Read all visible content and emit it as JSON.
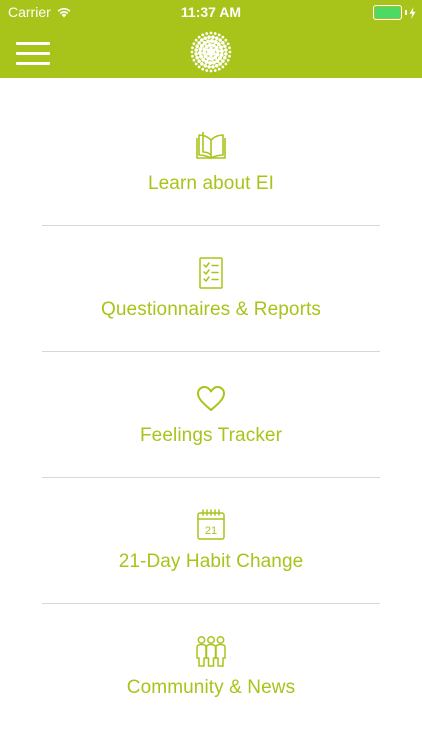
{
  "status_bar": {
    "carrier": "Carrier",
    "time": "11:37 AM",
    "battery_color": "#4cd964"
  },
  "header": {
    "background": "#a8c41a",
    "menu_icon": "hamburger-icon",
    "logo_icon": "sunburst-logo-icon"
  },
  "menu": {
    "accent_color": "#a8c41a",
    "items": [
      {
        "label": "Learn about EI",
        "icon": "book-icon"
      },
      {
        "label": "Questionnaires & Reports",
        "icon": "checklist-icon"
      },
      {
        "label": "Feelings Tracker",
        "icon": "heart-icon"
      },
      {
        "label": "21-Day Habit Change",
        "icon": "calendar-icon",
        "icon_text": "21"
      },
      {
        "label": "Community & News",
        "icon": "community-icon"
      }
    ]
  }
}
